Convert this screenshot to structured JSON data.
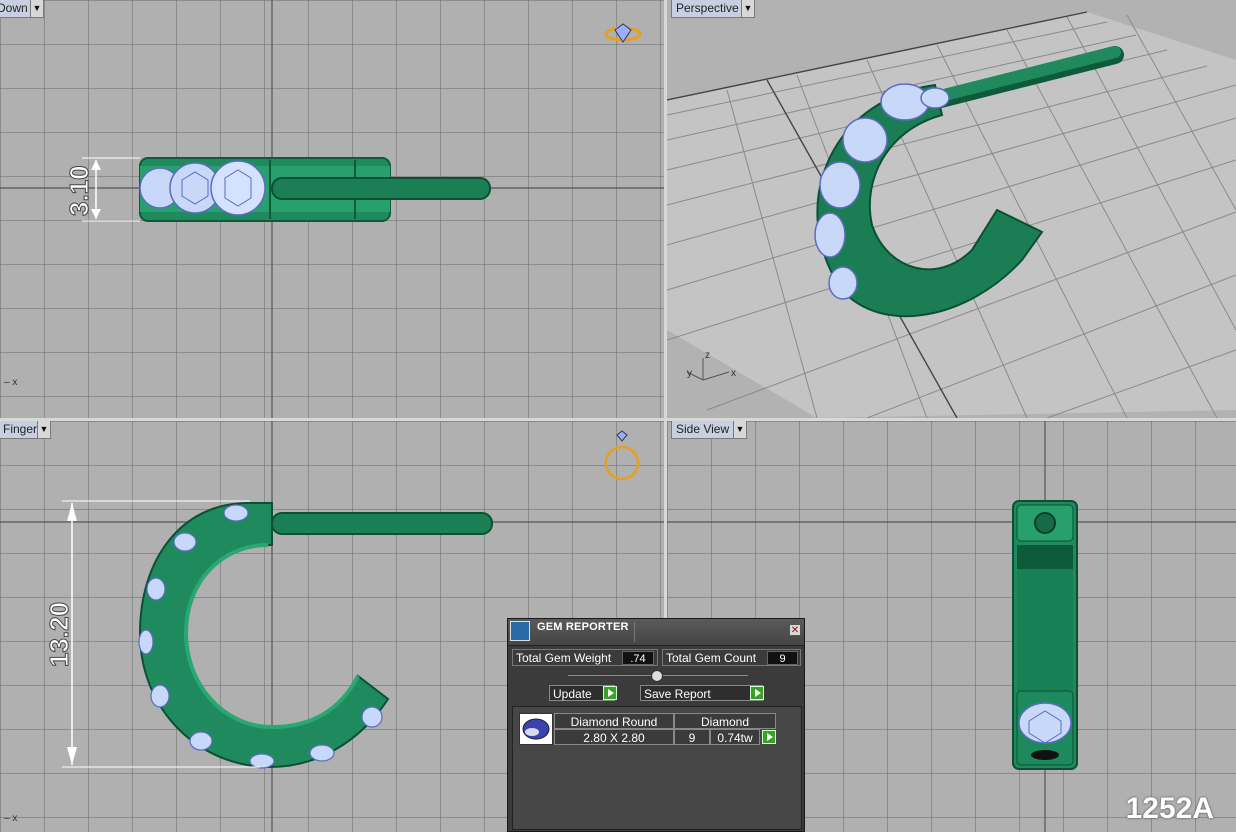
{
  "viewports": {
    "top_label": "Down",
    "perspective_label": "Perspective",
    "front_label": "Finger",
    "side_label": "Side View",
    "axis_x": "x",
    "axis_y": "y",
    "axis_z": "z"
  },
  "dimensions": {
    "height": "3.10",
    "width": "13.20"
  },
  "gem_reporter": {
    "title": "GEM REPORTER",
    "total_weight_label": "Total Gem Weight",
    "total_weight_value": ".74",
    "total_count_label": "Total Gem Count",
    "total_count_value": "9",
    "update_label": "Update",
    "save_report_label": "Save Report",
    "columns": {
      "shape": "Diamond Round",
      "material": "Diamond"
    },
    "row": {
      "size": "2.80 X 2.80",
      "count": "9",
      "weight": "0.74tw"
    },
    "close_glyph": "✕"
  },
  "footer_code": "1252A",
  "colors": {
    "metal": "#1f8a5e",
    "metal_dark": "#0f5a3a",
    "gem": "#c8d8f8",
    "viewport_bg": "#b0b0b0",
    "panel_bg": "#3b3b3b"
  }
}
